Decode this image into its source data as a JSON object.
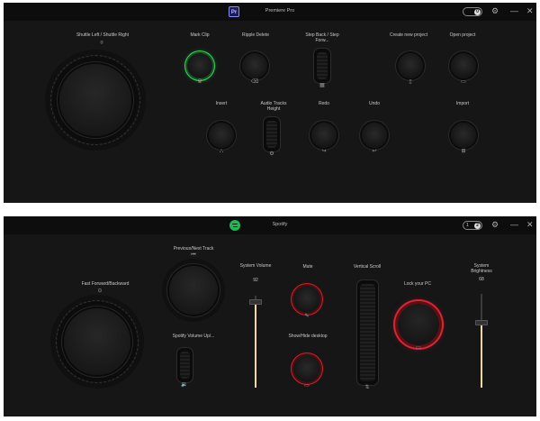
{
  "premiere": {
    "app_title": "Premiere Pro",
    "logo_text": "Pr",
    "toggle_value": "0",
    "controls": {
      "shuttle": "Shuttle Left / Shuttle Right",
      "mark_clip": "Mark Clip",
      "ripple_delete": "Ripple Delete",
      "step": "Step Back / Step Forw...",
      "create_project": "Create new project",
      "open_project": "Open project",
      "insert": "Insert",
      "audio_tracks": "Audio Tracks Height",
      "redo": "Redo",
      "undo": "Undo",
      "import": "Import"
    }
  },
  "spotify": {
    "app_title": "Spotify",
    "toggle_value": "1",
    "toggle_knob": "2",
    "controls": {
      "fast_forward": "Fast Forward/Backward",
      "prev_next": "Previous/Next Track",
      "system_volume": "System Volume",
      "system_volume_value": "92",
      "mute": "Mute",
      "vertical_scroll": "Vertical Scroll",
      "lock_pc": "Lock your PC",
      "system_brightness": "System Brightness",
      "system_brightness_value": "68",
      "spotify_volume": "Spotify Volume Up/...",
      "show_hide_desktop": "Show/Hide desktop"
    },
    "levels": {
      "system_volume": 0.92,
      "system_brightness": 0.68
    }
  },
  "colors": {
    "accent_green": "#2ee05a",
    "accent_red": "#d82532",
    "slider_fill": "#f0d9a0"
  }
}
